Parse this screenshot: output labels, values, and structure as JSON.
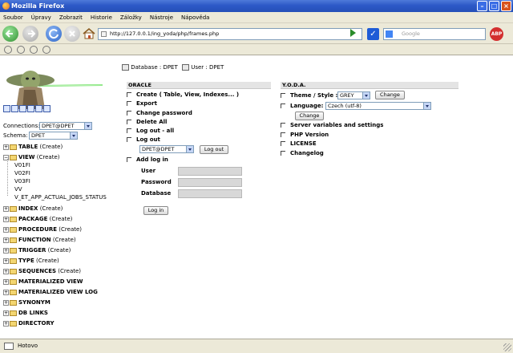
{
  "window": {
    "title": "Mozilla Firefox"
  },
  "menu": [
    "Soubor",
    "Úpravy",
    "Zobrazit",
    "Historie",
    "Záložky",
    "Nástroje",
    "Nápověda"
  ],
  "nav": {
    "url": "http://127.0.0.1/ing_yoda/php/frames.php",
    "search_placeholder": "Google",
    "abp_label": "ABP"
  },
  "status": {
    "text": "Hotovo"
  },
  "left": {
    "connections_label": "Connections:",
    "connections_value": "DPET@DPET",
    "schema_label": "Schema:",
    "schema_value": "DPET",
    "tree": {
      "table": "TABLE",
      "view": "VIEW",
      "create": "(Create)",
      "view_children": [
        "V01FI",
        "V02FI",
        "V03FI",
        "VV",
        "V_ET_APP_ACTUAL_JOBS_STATUS"
      ],
      "groups": [
        {
          "label": "INDEX",
          "create": "(Create)"
        },
        {
          "label": "PACKAGE",
          "create": "(Create)"
        },
        {
          "label": "PROCEDURE",
          "create": "(Create)"
        },
        {
          "label": "FUNCTION",
          "create": "(Create)"
        },
        {
          "label": "TRIGGER",
          "create": "(Create)"
        },
        {
          "label": "TYPE",
          "create": "(Create)"
        },
        {
          "label": "SEQUENCES",
          "create": "(Create)"
        },
        {
          "label": "MATERIALIZED VIEW",
          "create": ""
        },
        {
          "label": "MATERIALIZED VIEW LOG",
          "create": ""
        },
        {
          "label": "SYNONYM",
          "create": ""
        },
        {
          "label": "DB LINKS",
          "create": ""
        },
        {
          "label": "DIRECTORY",
          "create": ""
        }
      ]
    }
  },
  "middle": {
    "database_label": "Database : DPET",
    "user_label": "User : DPET",
    "header": "ORACLE",
    "items": [
      "Create ( Table, View, Indexes... )",
      "Export",
      "Change password",
      "Delete All",
      "Log out - all",
      "Log out"
    ],
    "logout_select": "DPET@DPET",
    "logout_button": "Log out",
    "add_login": "Add log in",
    "user_field": "User",
    "password_field": "Password",
    "database_field": "Database",
    "login_button": "Log in"
  },
  "right": {
    "header": "Y.O.D.A.",
    "theme_label": "Theme / Style :",
    "theme_value": "GREY",
    "change_label": "Change",
    "language_label": "Language:",
    "language_value": "Czech (utf-8)",
    "items": [
      "Server variables and settings",
      "PHP Version",
      "LICENSE",
      "Changelog"
    ]
  }
}
